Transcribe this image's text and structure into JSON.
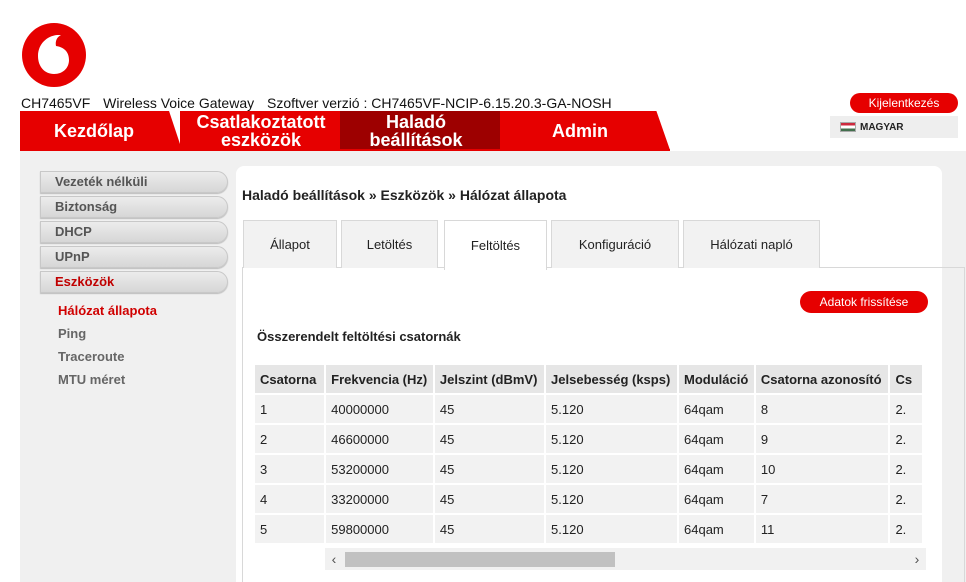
{
  "header": {
    "device_model": "CH7465VF",
    "device_desc": "Wireless Voice Gateway",
    "firmware_label": "Szoftver verzió : CH7465VF-NCIP-6.15.20.3-GA-NOSH",
    "logout_label": "Kijelentkezés",
    "language_label": "MAGYAR",
    "logo_icon": "vodafone-logo-icon",
    "brand_color": "#e60000"
  },
  "nav": {
    "home": "Kezdőlap",
    "devices": "Csatlakoztatott\neszközök",
    "advanced": "Haladó\nbeállítások",
    "admin": "Admin"
  },
  "sidebar": {
    "items": [
      {
        "label": "Vezeték nélküli"
      },
      {
        "label": "Biztonság"
      },
      {
        "label": "DHCP"
      },
      {
        "label": "UPnP"
      },
      {
        "label": "Eszközök"
      }
    ],
    "subitems": [
      {
        "label": "Hálózat állapota"
      },
      {
        "label": "Ping"
      },
      {
        "label": "Traceroute"
      },
      {
        "label": "MTU méret"
      }
    ]
  },
  "breadcrumb": "Haladó beállítások » Eszközök » Hálózat állapota",
  "tabs": [
    {
      "label": "Állapot"
    },
    {
      "label": "Letöltés"
    },
    {
      "label": "Feltöltés"
    },
    {
      "label": "Konfiguráció"
    },
    {
      "label": "Hálózati napló"
    }
  ],
  "refresh_label": "Adatok frissítése",
  "section_title": "Összerendelt feltöltési csatornák",
  "table": {
    "headers": [
      "Csatorna",
      "Frekvencia (Hz)",
      "Jelszint (dBmV)",
      "Jelsebesség (ksps)",
      "Moduláció",
      "Csatorna azonosító",
      "Cs"
    ],
    "rows": [
      [
        "1",
        "40000000",
        "45",
        "5.120",
        "64qam",
        "8",
        "2."
      ],
      [
        "2",
        "46600000",
        "45",
        "5.120",
        "64qam",
        "9",
        "2."
      ],
      [
        "3",
        "53200000",
        "45",
        "5.120",
        "64qam",
        "10",
        "2."
      ],
      [
        "4",
        "33200000",
        "45",
        "5.120",
        "64qam",
        "7",
        "2."
      ],
      [
        "5",
        "59800000",
        "45",
        "5.120",
        "64qam",
        "11",
        "2."
      ]
    ]
  }
}
